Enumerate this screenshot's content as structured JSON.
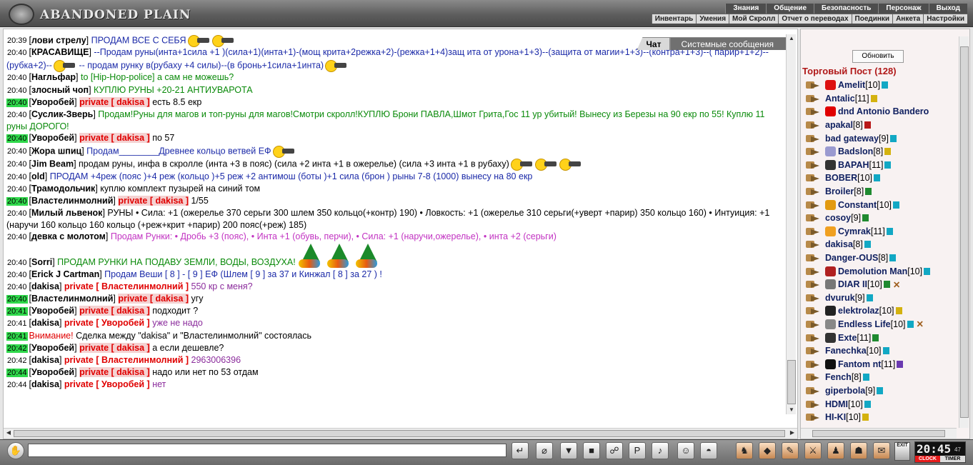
{
  "app": {
    "title": "ABANDONED PLAIN"
  },
  "nav_main": [
    "Знания",
    "Общение",
    "Безопасность",
    "Персонаж",
    "Выход"
  ],
  "nav_sub": [
    "Инвентарь",
    "Умения",
    "Мой Скролл",
    "Отчет о переводах",
    "Поединки",
    "Анкета",
    "Настройки"
  ],
  "tabs": [
    {
      "label": "Чат",
      "active": true
    },
    {
      "label": "Системные сообщения",
      "active": false
    }
  ],
  "messages": [
    {
      "time": "20:39",
      "nick": "лови стрелу",
      "text": "ПРОДАМ ВСЕ С СЕБЯ",
      "color": "blue",
      "icons": [
        "smiley-icon",
        "smiley-icon"
      ]
    },
    {
      "time": "20:40",
      "nick": "КРАСАВИЩЕ",
      "text": "--Продам руны(инта+1сила +1 )(сила+1)(инта+1)-(мощ крита+2режка+2)-(режка+1+4)защ ита от урона+1+3)--(защита от магии+1+3)--(контра+1+3)--( парир+1+2)--(рубка+2)--",
      "text2": " -- продам рунку в(рубаху +4 силы)--(в бронь+1сила+1инта)",
      "color": "blue",
      "icons": [
        "smiley-icon"
      ],
      "icons2": [
        "smiley-icon"
      ]
    },
    {
      "time": "20:40",
      "nick": "Нагльфар",
      "text": "to [Hip-Hop-police] а сам не можешь?",
      "color": "green"
    },
    {
      "time": "20:40",
      "nick": "злосный чоп",
      "text": "КУПЛЮ РУНЫ +20-21 АНТИУВАРОТА",
      "color": "green"
    },
    {
      "time": "20:40",
      "ts_hl": true,
      "nick": "Уворобей",
      "private": "private [ dakisa ]",
      "text": "есть 8.5 екр",
      "color": "black"
    },
    {
      "time": "20:40",
      "nick": "Суслик-Зверь",
      "text": "Продам!Руны для магов и топ-руны для магов!Смотри скролл!КУПЛЮ Брони ПАВЛА,Шмот Грита,Гос 11 ур убитый! Вынесу из Березы на 90 екр по 55! Куплю 11 руны ДОРОГО!",
      "color": "green"
    },
    {
      "time": "20:40",
      "ts_hl": true,
      "nick": "Уворобей",
      "private": "private [ dakisa ]",
      "text": "по 57",
      "color": "black"
    },
    {
      "time": "20:40",
      "nick": "Жора шпиц",
      "text": "Продам________Древнее кольцо ветвей ЕФ",
      "color": "blue",
      "icons": [
        "smiley-icon"
      ]
    },
    {
      "time": "20:40",
      "nick": "Jim Beam",
      "text": "продам руны, инфа в скролле (инта +3 в пояс) (сила +2 инта +1 в ожерелье) (сила +3 инта +1 в рубаху)",
      "color": "black",
      "icons": [
        "smiley-icon",
        "smiley-icon",
        "smiley-icon"
      ]
    },
    {
      "time": "20:40",
      "nick": "old",
      "text": "ПРОДАМ +4реж (пояс )+4 реж (кольцо )+5 реж +2 антимош (боты )+1 сила (брон ) рыны 7-8 (1000) вынесу на 80 екр",
      "color": "blue"
    },
    {
      "time": "20:40",
      "nick": "Трамодольчик",
      "text": "куплю комплект пузырей на синий том",
      "color": "black"
    },
    {
      "time": "20:40",
      "ts_hl": true,
      "nick": "Властелинмолний",
      "private": "private [ dakisa ]",
      "text": "1/55",
      "color": "black"
    },
    {
      "time": "20:40",
      "nick": "Милый львенок",
      "text": "РУНЫ • Сила: +1 (ожерелье 370 серьги 300 шлем 350 кольцо(+контр) 190) • Ловкость: +1 (ожерелье 310 серьги(+уверт +парир) 350 кольцо 160) • Интуиция: +1 (наручи 160 кольцо 160 кольцо (+реж+крит +парир) 200 пояс(+реж) 185)",
      "color": "black"
    },
    {
      "time": "20:40",
      "nick": "девка с молотом",
      "text": "Продам Рунки: • Дробь +3 (пояс), • Инта +1 (обувь, перчи), • Сила: +1 (наручи,ожерелье), • инта +2 (серьги)",
      "color": "pink"
    },
    {
      "time": "20:40",
      "nick": "Sorri",
      "text": "ПРОДАМ РУНКИ НА ПОДАВУ ЗЕМЛИ, ВОДЫ, ВОЗДУХА!",
      "color": "green",
      "trees": 3
    },
    {
      "time": "20:40",
      "nick": "Erick J Cartman",
      "text": "Продам Веши [ 8 ] - [ 9 ] ЕФ (Шлем [ 9 ] за 37 и Кинжал [ 8 ] за 27 ) !",
      "color": "blue"
    },
    {
      "time": "20:40",
      "nick": "dakisa",
      "private": "private [ Властелинмолний ]",
      "text": "550 кр с меня?",
      "color": "purple"
    },
    {
      "time": "20:40",
      "ts_hl": true,
      "nick": "Властелинмолний",
      "private": "private [ dakisa ]",
      "text": "угу",
      "color": "black"
    },
    {
      "time": "20:41",
      "ts_hl": true,
      "nick": "Уворобей",
      "private": "private [ dakisa ]",
      "text": "подходит ?",
      "color": "black"
    },
    {
      "time": "20:41",
      "nick": "dakisa",
      "private": "private [ Уворобей ]",
      "text": "уже не надо",
      "color": "purple"
    },
    {
      "time": "20:41",
      "ts_hl": true,
      "system": "Внимание!",
      "text": "Сделка между \"dakisa\" и \"Властелинмолний\" состоялась",
      "color": "black"
    },
    {
      "time": "20:42",
      "ts_hl": true,
      "nick": "Уворобей",
      "private": "private [ dakisa ]",
      "text": "а если дешевле?",
      "color": "black"
    },
    {
      "time": "20:42",
      "nick": "dakisa",
      "private": "private [ Властелинмолний ]",
      "text": "2963006396",
      "color": "purple"
    },
    {
      "time": "20:44",
      "ts_hl": true,
      "nick": "Уворобей",
      "private": "private [ dakisa ]",
      "text": "надо или нет по 53 отдам",
      "color": "black"
    },
    {
      "time": "20:44",
      "nick": "dakisa",
      "private": "private [ Уворобей ]",
      "text": "нет",
      "color": "purple"
    }
  ],
  "sidebar": {
    "refresh_label": "Обновить",
    "title": "Торговый Пост (128)",
    "users": [
      {
        "name": "Amelit",
        "level": "[10]",
        "icon": "#d11",
        "info": "#12a8c4"
      },
      {
        "name": "Antalic",
        "level": "[11]",
        "info": "#d4b20f"
      },
      {
        "name": "dnd Antonio Bandero",
        "level": "",
        "icon": "#e00000",
        "icon_name": "dollar-icon"
      },
      {
        "name": "apakal",
        "level": "[8]",
        "info": "#b81818"
      },
      {
        "name": "bad gateway",
        "level": "[9]",
        "info": "#12a8c4"
      },
      {
        "name": "Badslon",
        "level": "[8]",
        "icon": "#9a9ad0",
        "info": "#d4b20f"
      },
      {
        "name": "BAPAH",
        "level": "[11]",
        "icon": "#333",
        "info": "#12a8c4"
      },
      {
        "name": "BOBER",
        "level": "[10]",
        "info": "#12a8c4"
      },
      {
        "name": "Broiler",
        "level": "[8]",
        "info": "#1f8a30"
      },
      {
        "name": "Constant",
        "level": "[10]",
        "icon": "#e29a10",
        "info": "#12a8c4"
      },
      {
        "name": "cosoy",
        "level": "[9]",
        "info": "#1f8a30"
      },
      {
        "name": "Cymrak",
        "level": "[11]",
        "icon": "#f0a020",
        "info": "#12a8c4"
      },
      {
        "name": "dakisa",
        "level": "[8]",
        "info": "#12a8c4"
      },
      {
        "name": "Danger-OUS",
        "level": "[8]",
        "info": "#12a8c4"
      },
      {
        "name": "Demolution Man",
        "level": "[10]",
        "icon": "#b02020",
        "info": "#12a8c4"
      },
      {
        "name": "DIAR II",
        "level": "[10]",
        "icon": "#777",
        "info": "#1f8a30",
        "x": true
      },
      {
        "name": "dvuruk",
        "level": "[9]",
        "info": "#12a8c4"
      },
      {
        "name": "elektrolaz",
        "level": "[10]",
        "icon": "#222",
        "info": "#d4b20f"
      },
      {
        "name": "Endless Life",
        "level": "[10]",
        "icon": "#888",
        "info": "#12a8c4",
        "x": true
      },
      {
        "name": "Exte",
        "level": "[11]",
        "icon": "#333",
        "info": "#1f8a30"
      },
      {
        "name": "Fanechka",
        "level": "[10]",
        "info": "#12a8c4"
      },
      {
        "name": "Fantom nt",
        "level": "[11]",
        "icon": "#111",
        "info": "#6a3ab0"
      },
      {
        "name": "Fench",
        "level": "[8]",
        "info": "#12a8c4"
      },
      {
        "name": "giperbola",
        "level": "[9]",
        "info": "#12a8c4"
      },
      {
        "name": "HDMI",
        "level": "[10]",
        "info": "#12a8c4"
      },
      {
        "name": "HI-KI",
        "level": "[10]",
        "info": "#d4b20f"
      }
    ]
  },
  "input": {
    "value": ""
  },
  "toolbar_left": [
    {
      "name": "send-icon",
      "glyph": "↵"
    },
    {
      "name": "clear-icon",
      "glyph": "⌀"
    },
    {
      "name": "filter-icon",
      "glyph": "▼"
    },
    {
      "name": "save-icon",
      "glyph": "■"
    },
    {
      "name": "fight-icon",
      "glyph": "☍"
    },
    {
      "name": "translit-icon",
      "glyph": "Р"
    },
    {
      "name": "music-icon",
      "glyph": "♪"
    },
    {
      "name": "smiles-icon",
      "glyph": "☺"
    },
    {
      "name": "helmet-icon",
      "glyph": "◓"
    }
  ],
  "toolbar_right": [
    {
      "name": "bag-icon",
      "glyph": "♞"
    },
    {
      "name": "inventory-icon",
      "glyph": "◆"
    },
    {
      "name": "scroll-icon",
      "glyph": "✎"
    },
    {
      "name": "battle-icon",
      "glyph": "⚔"
    },
    {
      "name": "character-icon",
      "glyph": "♟"
    },
    {
      "name": "friends-icon",
      "glyph": "☗"
    },
    {
      "name": "mail-icon",
      "glyph": "✉"
    }
  ],
  "exit_label": "EXIT",
  "clock": {
    "time": "20:45",
    "seconds": "47",
    "clock_label": "CLOCK",
    "timer_label": "TIMER"
  }
}
